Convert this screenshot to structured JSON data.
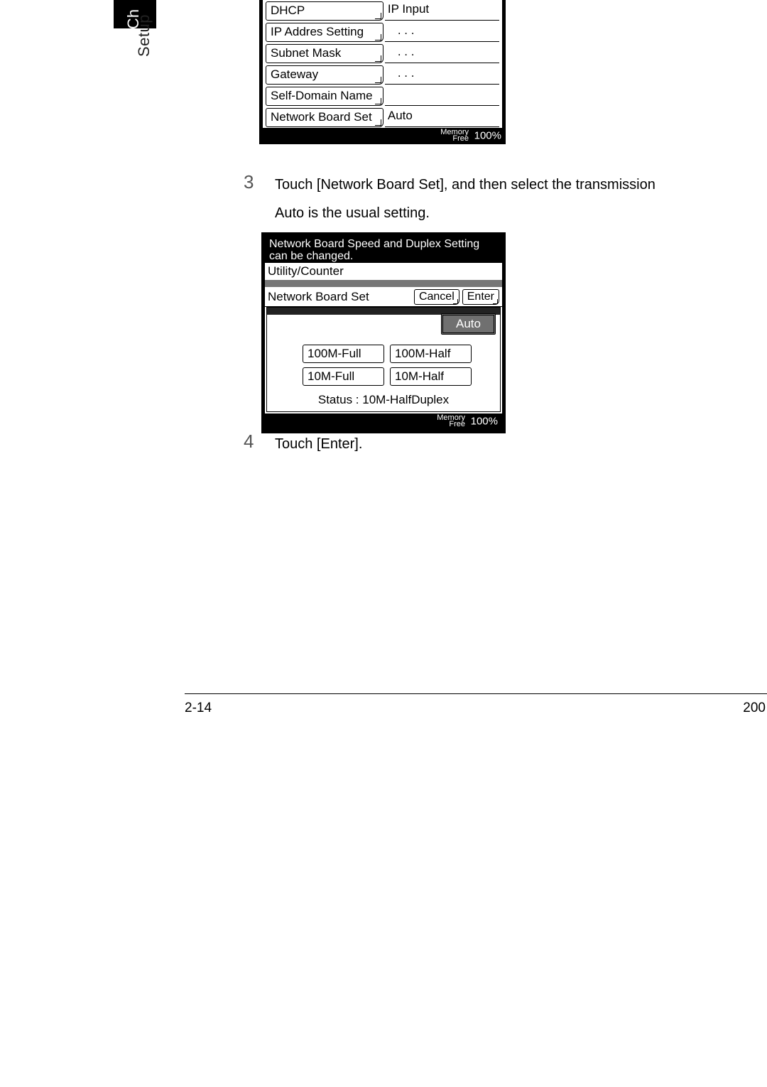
{
  "margin": {
    "tab": "Ch",
    "setup": "Setup"
  },
  "panel1": {
    "rows": {
      "dhcp": {
        "label": "DHCP",
        "value": "IP Input"
      },
      "ip": {
        "label": "IP Addres Setting",
        "value": "   .      .      ."
      },
      "mask": {
        "label": "Subnet Mask",
        "value": "   .      .      ."
      },
      "gw": {
        "label": "Gateway",
        "value": "   .      .      ."
      },
      "self": {
        "label": "Self-Domain Name",
        "value": ""
      },
      "nbs": {
        "label": "Network Board Set",
        "value": "Auto"
      }
    },
    "memory": {
      "label1": "Memory",
      "label2": "Free",
      "pct": "100%"
    }
  },
  "step3": {
    "num": "3",
    "line1": "Touch [Network Board Set], and then select the transmission",
    "line2": "Auto  is the usual setting."
  },
  "panel2": {
    "hdr1": "Network Board Speed and Duplex Setting",
    "hdr2": "can be changed.",
    "util": "Utility/Counter",
    "title": "Network Board Set",
    "cancel": "Cancel",
    "enter": "Enter",
    "auto": "Auto",
    "opts": {
      "f100": "100M-Full",
      "h100": "100M-Half",
      "f10": "10M-Full",
      "h10": "10M-Half"
    },
    "status": "Status :  10M-HalfDuplex",
    "memory": {
      "label1": "Memory",
      "label2": "Free",
      "pct": "100%"
    }
  },
  "step4": {
    "num": "4",
    "line1": "Touch [Enter]."
  },
  "footer": {
    "left": "2-14",
    "right": "200"
  }
}
